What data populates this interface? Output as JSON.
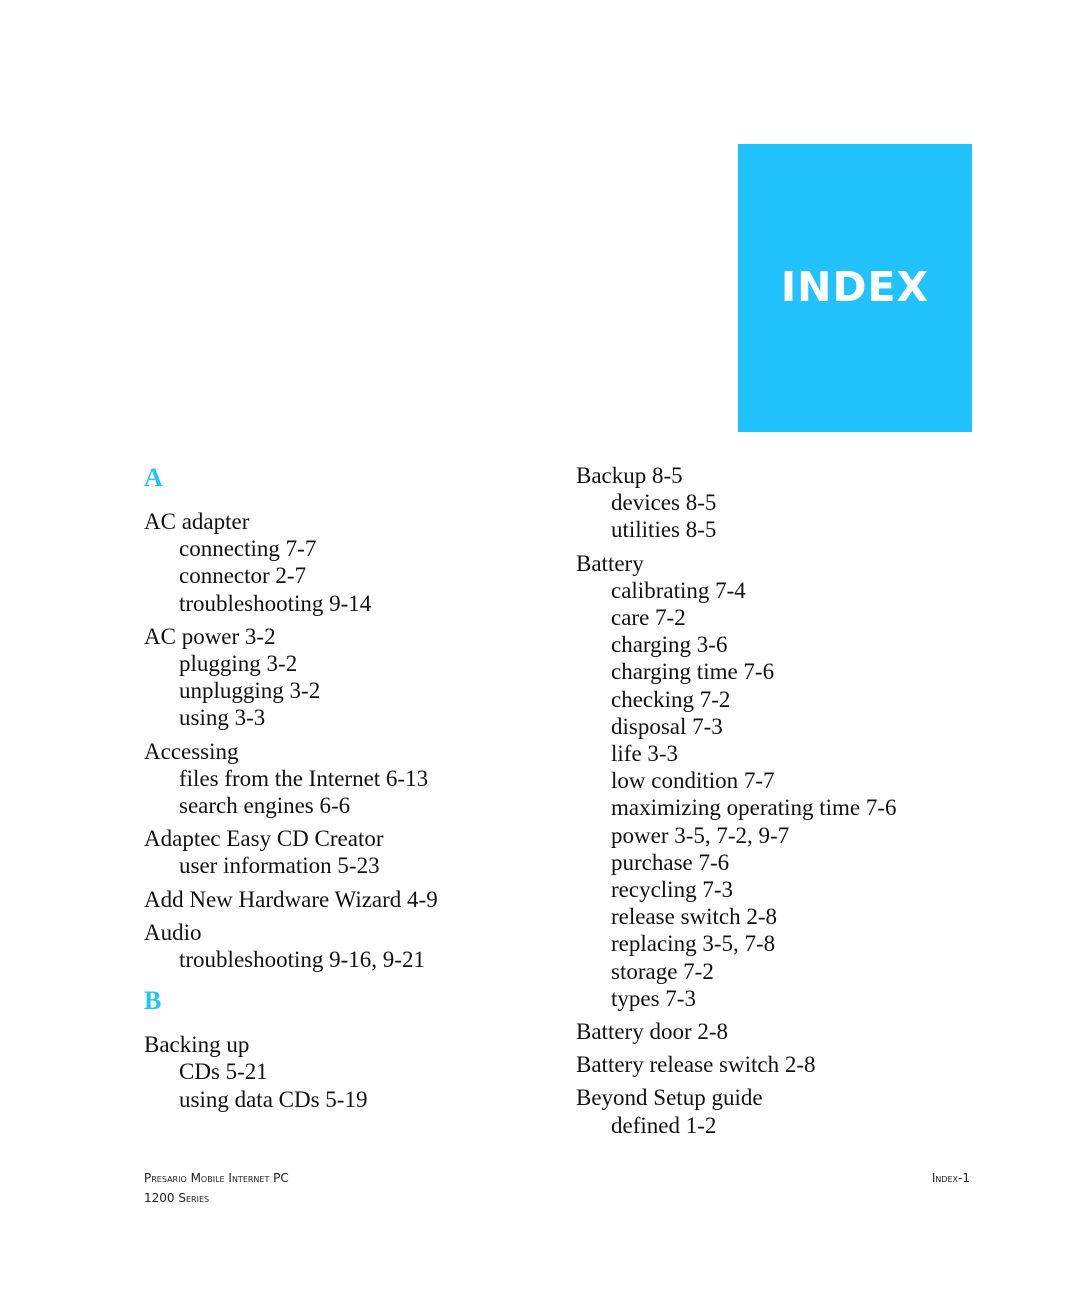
{
  "header": {
    "title": "INDEX",
    "accent_color": "#22c3fd"
  },
  "left_column": {
    "sections": [
      {
        "letter": "A",
        "entries": [
          {
            "term": "AC adapter",
            "subs": [
              "connecting 7-7",
              "connector 2-7",
              "troubleshooting 9-14"
            ]
          },
          {
            "term": "AC power 3-2",
            "subs": [
              "plugging 3-2",
              "unplugging 3-2",
              "using 3-3"
            ]
          },
          {
            "term": "Accessing",
            "subs": [
              "files from the Internet 6-13",
              "search engines 6-6"
            ]
          },
          {
            "term": "Adaptec Easy CD Creator",
            "subs": [
              "user information 5-23"
            ]
          },
          {
            "term": "Add New Hardware Wizard 4-9",
            "subs": []
          },
          {
            "term": "Audio",
            "subs": [
              "troubleshooting 9-16, 9-21"
            ]
          }
        ]
      },
      {
        "letter": "B",
        "entries": [
          {
            "term": "Backing up",
            "subs": [
              "CDs 5-21",
              "using data CDs 5-19"
            ]
          }
        ]
      }
    ]
  },
  "right_column": {
    "entries": [
      {
        "term": "Backup 8-5",
        "subs": [
          "devices 8-5",
          "utilities 8-5"
        ]
      },
      {
        "term": "Battery",
        "subs": [
          "calibrating 7-4",
          "care 7-2",
          "charging 3-6",
          "charging time 7-6",
          "checking 7-2",
          "disposal 7-3",
          "life 3-3",
          "low condition 7-7",
          "maximizing operating time 7-6",
          "power 3-5, 7-2, 9-7",
          "purchase 7-6",
          "recycling 7-3",
          "release switch 2-8",
          "replacing 3-5, 7-8",
          "storage 7-2",
          "types 7-3"
        ]
      },
      {
        "term": "Battery door 2-8",
        "subs": []
      },
      {
        "term": "Battery release switch 2-8",
        "subs": []
      },
      {
        "term": "Beyond Setup guide",
        "subs": [
          "defined 1-2"
        ]
      }
    ]
  },
  "footer": {
    "product_line1": "Presario Mobile Internet PC",
    "product_line2": "1200 Series",
    "page_label": "Index-1"
  }
}
